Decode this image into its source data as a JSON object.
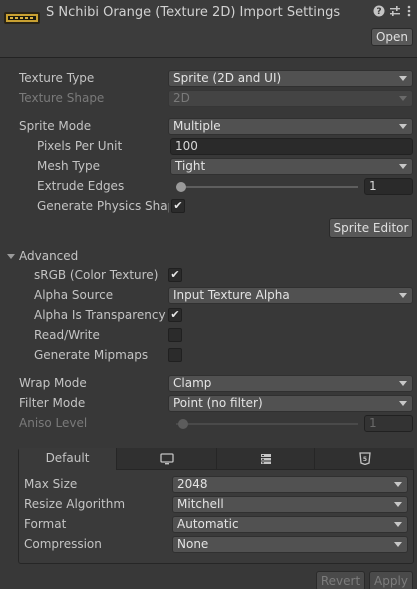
{
  "header": {
    "title": "S Nchibi Orange (Texture 2D) Import Settings",
    "open_label": "Open",
    "help_icon": "help-icon",
    "settings_icon": "sliders-icon",
    "menu_icon": "kebab-menu-icon"
  },
  "fields": {
    "texture_type": {
      "label": "Texture Type",
      "value": "Sprite (2D and UI)"
    },
    "texture_shape": {
      "label": "Texture Shape",
      "value": "2D"
    },
    "sprite_mode": {
      "label": "Sprite Mode",
      "value": "Multiple"
    },
    "pixels_per_unit": {
      "label": "Pixels Per Unit",
      "value": "100"
    },
    "mesh_type": {
      "label": "Mesh Type",
      "value": "Tight"
    },
    "extrude_edges": {
      "label": "Extrude Edges",
      "value": "1",
      "slider_fraction": 0.0
    },
    "generate_physics_shape": {
      "label": "Generate Physics Shap",
      "checked": true
    },
    "sprite_editor_label": "Sprite Editor"
  },
  "advanced": {
    "label": "Advanced",
    "srgb": {
      "label": "sRGB (Color Texture)",
      "checked": true
    },
    "alpha_source": {
      "label": "Alpha Source",
      "value": "Input Texture Alpha"
    },
    "alpha_is_transparency": {
      "label": "Alpha Is Transparency",
      "checked": true
    },
    "read_write": {
      "label": "Read/Write",
      "checked": false
    },
    "generate_mipmaps": {
      "label": "Generate Mipmaps",
      "checked": false
    }
  },
  "wrap": {
    "wrap_mode": {
      "label": "Wrap Mode",
      "value": "Clamp"
    },
    "filter_mode": {
      "label": "Filter Mode",
      "value": "Point (no filter)"
    },
    "aniso_level": {
      "label": "Aniso Level",
      "value": "1",
      "slider_fraction": 0.0
    }
  },
  "platform": {
    "tabs": [
      {
        "label": "Default",
        "icon": ""
      },
      {
        "label": "",
        "icon": "monitor-icon"
      },
      {
        "label": "",
        "icon": "server-icon"
      },
      {
        "label": "",
        "icon": "html5-icon"
      }
    ],
    "max_size": {
      "label": "Max Size",
      "value": "2048"
    },
    "resize_algorithm": {
      "label": "Resize Algorithm",
      "value": "Mitchell"
    },
    "format": {
      "label": "Format",
      "value": "Automatic"
    },
    "compression": {
      "label": "Compression",
      "value": "None"
    }
  },
  "footer": {
    "revert_label": "Revert",
    "apply_label": "Apply"
  },
  "colors": {
    "background": "#383838",
    "dropdown": "#515151",
    "text": "#c4c4c4"
  }
}
